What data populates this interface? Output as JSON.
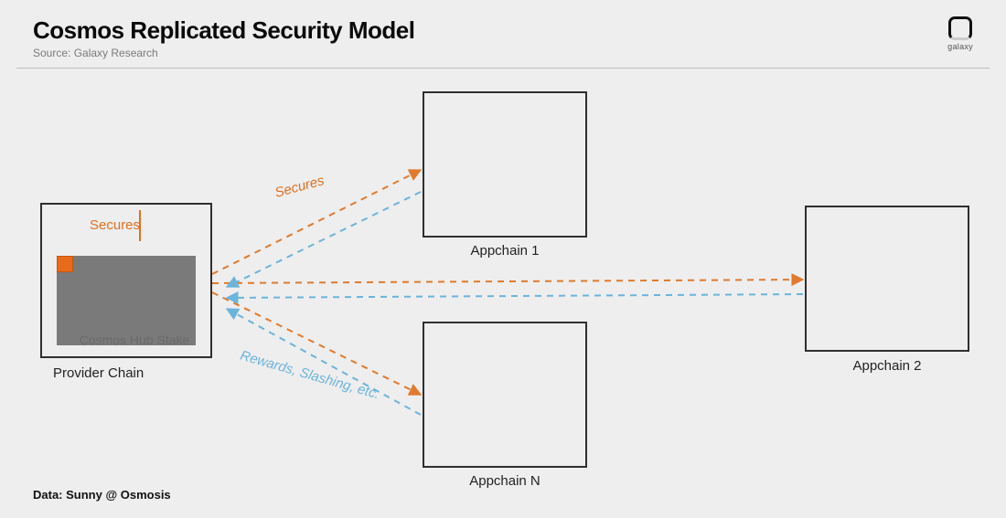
{
  "header": {
    "title": "Cosmos Replicated Security Model",
    "source": "Source: Galaxy Research"
  },
  "logo": {
    "text": "galaxy"
  },
  "provider": {
    "box_label": "Provider Chain",
    "secures_label": "Secures",
    "stake_label": "Cosmos Hub Stake"
  },
  "appchains": {
    "a1_label": "Appchain 1",
    "a2_label": "Appchain 2",
    "an_label": "Appchain N"
  },
  "edges": {
    "secures_label": "Secures",
    "rewards_label": "Rewards, Slashing, etc.",
    "colors": {
      "secures": "#e07a2c",
      "rewards": "#6bb4db"
    }
  },
  "footer": {
    "data_credit": "Data: Sunny @ Osmosis"
  }
}
